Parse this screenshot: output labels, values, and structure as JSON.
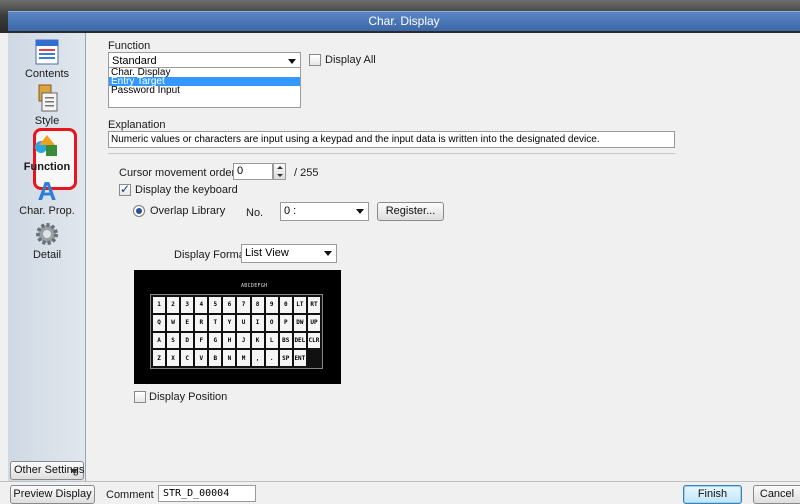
{
  "window": {
    "title": "Char. Display"
  },
  "sidebar": {
    "items": [
      {
        "label": "Contents"
      },
      {
        "label": "Style"
      },
      {
        "label": "Function"
      },
      {
        "label": "Char. Prop."
      },
      {
        "label": "Detail"
      }
    ],
    "other_settings_label": "Other Settings",
    "active_highlight_color": "#e8141e"
  },
  "function": {
    "label": "Function",
    "selected": "Standard",
    "display_all_label": "Display All",
    "list": [
      "Char. Display",
      "Entry Target",
      "Password Input"
    ],
    "list_selected": "Entry Target"
  },
  "explanation": {
    "label": "Explanation",
    "text": "Numeric values or characters are input using a keypad and the input data is written into the designated device."
  },
  "cursor": {
    "label": "Cursor movement order",
    "value": "0",
    "max_label": "/ 255"
  },
  "keyboard": {
    "display_label": "Display the keyboard",
    "display_checked": true,
    "overlap_label": "Overlap Library",
    "no_label": "No.",
    "no_value": "0 :",
    "register_label": "Register..."
  },
  "display_format": {
    "label": "Display Format",
    "value": "List View"
  },
  "keyboard_preview": {
    "header": "ABCDEFGH",
    "rows": [
      [
        "1",
        "2",
        "3",
        "4",
        "5",
        "6",
        "7",
        "8",
        "9",
        "0",
        "LT",
        "RT"
      ],
      [
        "Q",
        "W",
        "E",
        "R",
        "T",
        "Y",
        "U",
        "I",
        "O",
        "P",
        "DW",
        "UP"
      ],
      [
        "A",
        "S",
        "D",
        "F",
        "G",
        "H",
        "J",
        "K",
        "L",
        "BS",
        "DEL",
        "CLR"
      ],
      [
        "Z",
        "X",
        "C",
        "V",
        "B",
        "N",
        "M",
        ",",
        ".",
        "SP",
        "ENT",
        ""
      ]
    ]
  },
  "display_position": {
    "label": "Display Position",
    "checked": false
  },
  "bottom": {
    "preview_label": "Preview Display",
    "comment_label": "Comment",
    "comment_value": "STR_D_00004",
    "finish_label": "Finish",
    "cancel_label": "Cancel"
  }
}
